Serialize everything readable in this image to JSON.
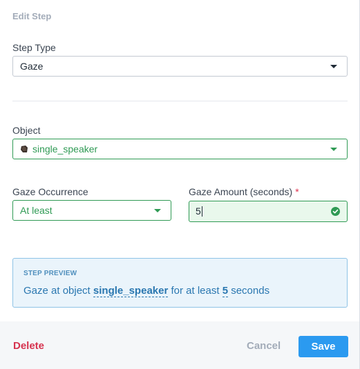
{
  "dialog": {
    "title": "Edit Step"
  },
  "step_type": {
    "label": "Step Type",
    "value": "Gaze"
  },
  "object": {
    "label": "Object",
    "value": "single_speaker",
    "icon": "speaker-object-icon"
  },
  "gaze_occurrence": {
    "label": "Gaze Occurrence",
    "value": "At least"
  },
  "gaze_amount": {
    "label": "Gaze Amount (seconds)",
    "required_marker": "*",
    "value": "5",
    "status_icon": "check-circle-icon"
  },
  "preview": {
    "title": "STEP PREVIEW",
    "text_1": "Gaze at object ",
    "object": "single_speaker",
    "text_2": " for at least ",
    "amount": "5",
    "text_3": " seconds"
  },
  "footer": {
    "delete_label": "Delete",
    "cancel_label": "Cancel",
    "save_label": "Save"
  },
  "colors": {
    "valid": "#2f9a54",
    "valid_bg": "#e9f8ec",
    "primary": "#2b9af0",
    "danger": "#d6334f",
    "preview_bg": "#eaf4fb",
    "preview_text": "#2a77b0"
  }
}
